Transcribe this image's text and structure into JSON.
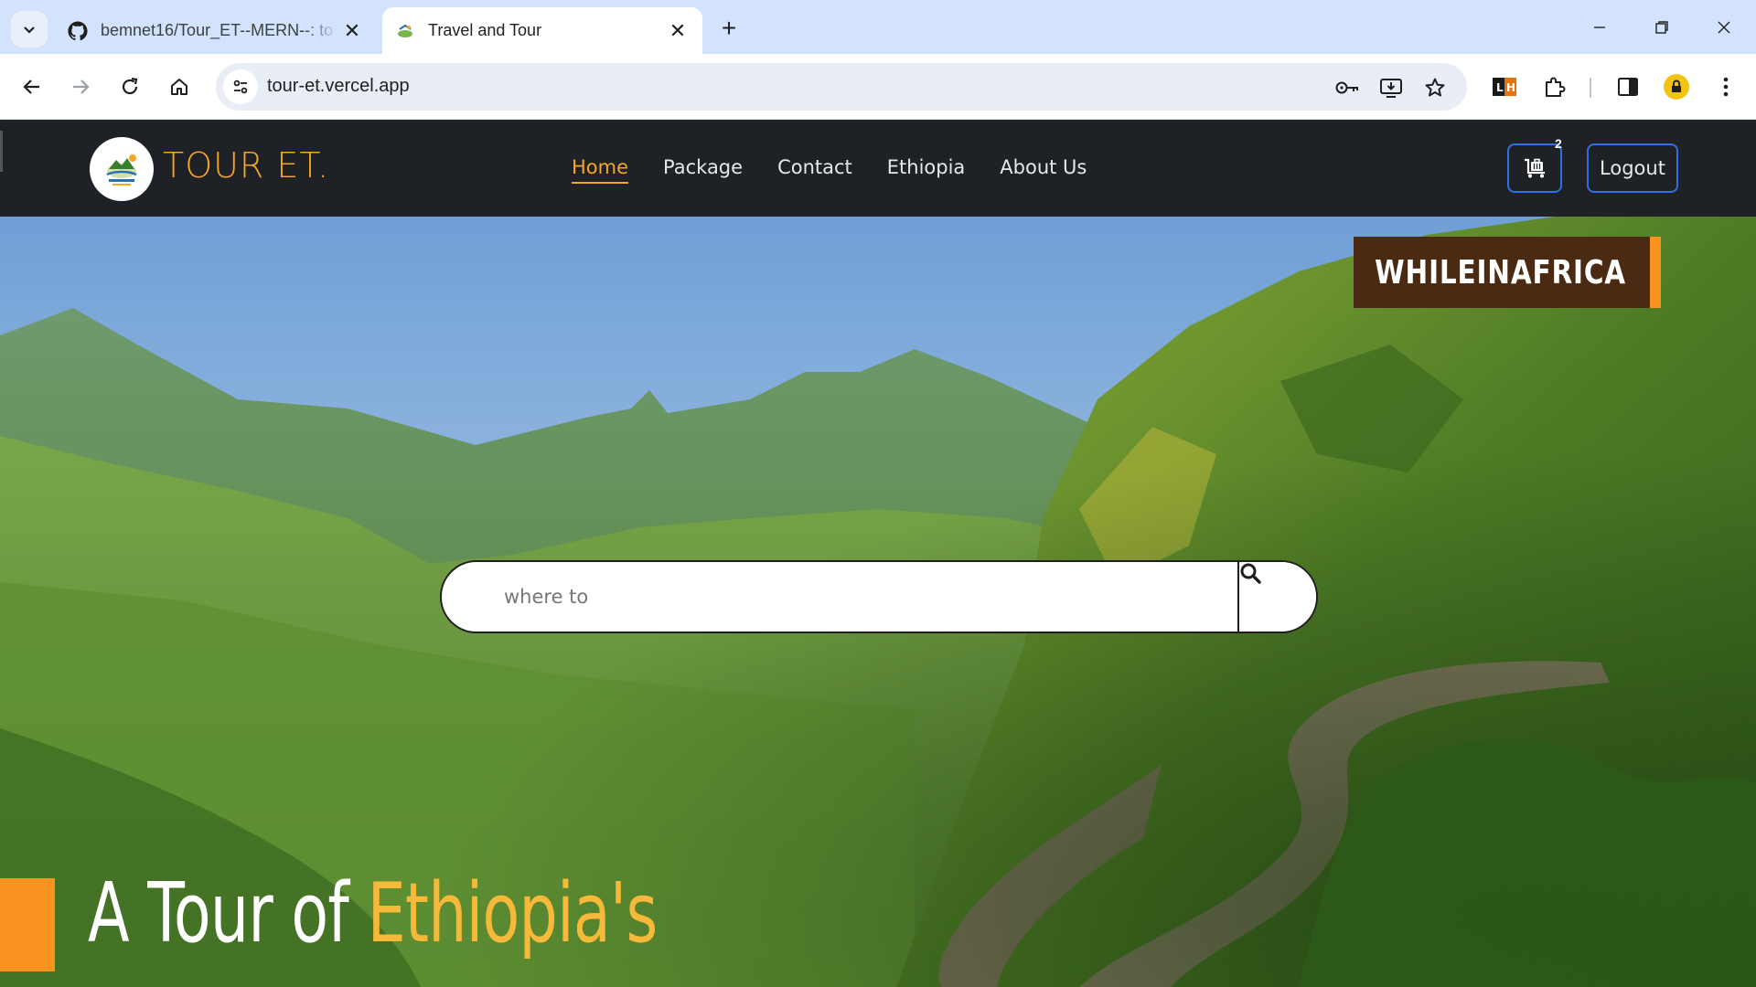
{
  "browser": {
    "tabs": [
      {
        "title": "bemnet16/Tour_ET--MERN--: to",
        "icon": "github-icon",
        "active": false
      },
      {
        "title": "Travel and Tour",
        "icon": "site-favicon",
        "active": true
      }
    ],
    "url": "tour-et.vercel.app",
    "extension_badge": "LH"
  },
  "site": {
    "brand": "TOUR ET.",
    "nav": [
      {
        "label": "Home",
        "active": true
      },
      {
        "label": "Package",
        "active": false
      },
      {
        "label": "Contact",
        "active": false
      },
      {
        "label": "Ethiopia",
        "active": false
      },
      {
        "label": "About Us",
        "active": false
      }
    ],
    "cart_count": "2",
    "logout_label": "Logout"
  },
  "hero": {
    "watermark": "WHILEINAFRICA",
    "search": {
      "placeholder": "where to",
      "value": ""
    },
    "tagline_white": "A Tour of ",
    "tagline_orange": "Ethiopia's"
  },
  "colors": {
    "accent": "#f5a623",
    "header_bg": "#1e2126",
    "button_border": "#2f6fe4",
    "tabstrip_bg": "#d3e3fd"
  }
}
